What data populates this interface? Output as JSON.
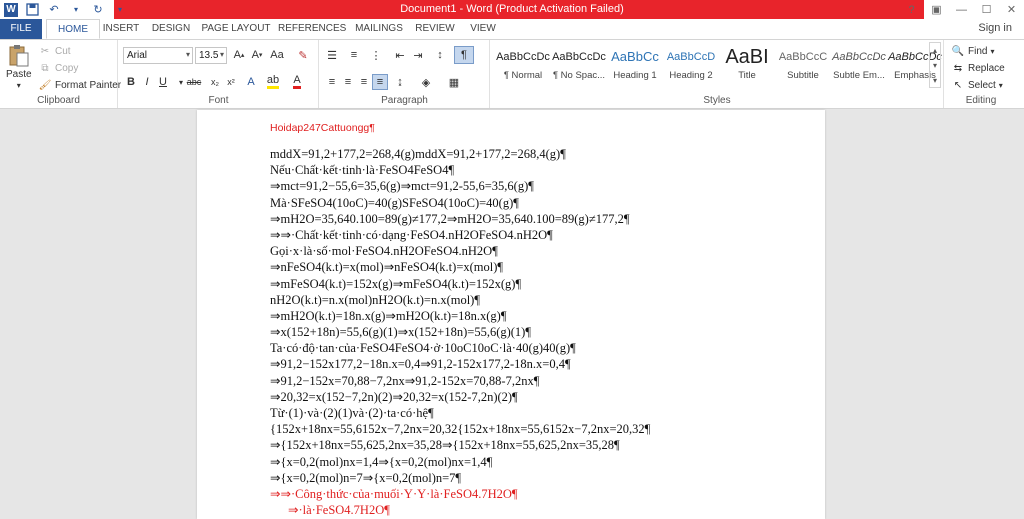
{
  "window": {
    "title": "Document1 - Word (Product Activation Failed)",
    "sign_in": "Sign in"
  },
  "tabs": [
    "FILE",
    "HOME",
    "INSERT",
    "DESIGN",
    "PAGE LAYOUT",
    "REFERENCES",
    "MAILINGS",
    "REVIEW",
    "VIEW"
  ],
  "active_tab": "HOME",
  "clipboard": {
    "paste": "Paste",
    "cut": "Cut",
    "copy": "Copy",
    "format_painter": "Format Painter",
    "label": "Clipboard"
  },
  "font": {
    "family": "Arial",
    "size": "13.5",
    "label": "Font",
    "buttons": [
      "B",
      "I",
      "U",
      "abc",
      "x₂",
      "x²"
    ]
  },
  "paragraph": {
    "label": "Paragraph"
  },
  "styles": {
    "label": "Styles",
    "items": [
      {
        "preview": "AaBbCcDc",
        "name": "¶ Normal"
      },
      {
        "preview": "AaBbCcDc",
        "name": "¶ No Spac..."
      },
      {
        "preview": "AaBbCc",
        "name": "Heading 1"
      },
      {
        "preview": "AaBbCcD",
        "name": "Heading 2"
      },
      {
        "preview": "AaBI",
        "name": "Title"
      },
      {
        "preview": "AaBbCcC",
        "name": "Subtitle"
      },
      {
        "preview": "AaBbCcDc",
        "name": "Subtle Em..."
      },
      {
        "preview": "AaBbCcDc",
        "name": "Emphasis"
      }
    ]
  },
  "editing": {
    "find": "Find",
    "replace": "Replace",
    "select": "Select",
    "label": "Editing"
  },
  "document": {
    "heading": "Hoidap247Cattuongg¶",
    "lines": [
      {
        "text": "mddX=91,2+177,2=268,4(g)mddX=91,2+177,2=268,4(g)¶",
        "red": false,
        "indent": false
      },
      {
        "text": "Nếu·Chất·kết·tinh·là·FeSO4FeSO4¶",
        "red": false,
        "indent": false
      },
      {
        "text": "⇒mct=91,2−55,6=35,6(g)⇒mct=91,2-55,6=35,6(g)¶",
        "red": false,
        "indent": false
      },
      {
        "text": "Mà·SFeSO4(10oC)=40(g)SFeSO4(10oC)=40(g)¶",
        "red": false,
        "indent": false
      },
      {
        "text": "⇒mH2O=35,640.100=89(g)≠177,2⇒mH2O=35,640.100=89(g)≠177,2¶",
        "red": false,
        "indent": false
      },
      {
        "text": "⇒⇒·Chất·kết·tinh·có·dạng·FeSO4.nH2OFeSO4.nH2O¶",
        "red": false,
        "indent": false
      },
      {
        "text": "Gọi·x·là·số·mol·FeSO4.nH2OFeSO4.nH2O¶",
        "red": false,
        "indent": false
      },
      {
        "text": "⇒nFeSO4(k.t)=x(mol)⇒nFeSO4(k.t)=x(mol)¶",
        "red": false,
        "indent": false
      },
      {
        "text": "⇒mFeSO4(k.t)=152x(g)⇒mFeSO4(k.t)=152x(g)¶",
        "red": false,
        "indent": false
      },
      {
        "text": "nH2O(k.t)=n.x(mol)nH2O(k.t)=n.x(mol)¶",
        "red": false,
        "indent": false
      },
      {
        "text": "⇒mH2O(k.t)=18n.x(g)⇒mH2O(k.t)=18n.x(g)¶",
        "red": false,
        "indent": false
      },
      {
        "text": "⇒x(152+18n)=55,6(g)(1)⇒x(152+18n)=55,6(g)(1)¶",
        "red": false,
        "indent": false
      },
      {
        "text": "Ta·có·độ·tan·của·FeSO4FeSO4·ở·10oC10oC·là·40(g)40(g)¶",
        "red": false,
        "indent": false
      },
      {
        "text": "⇒91,2−152x177,2−18n.x=0,4⇒91,2-152x177,2-18n.x=0,4¶",
        "red": false,
        "indent": false
      },
      {
        "text": "⇒91,2−152x=70,88−7,2nx⇒91,2-152x=70,88-7,2nx¶",
        "red": false,
        "indent": false
      },
      {
        "text": "⇒20,32=x(152−7,2n)(2)⇒20,32=x(152-7,2n)(2)¶",
        "red": false,
        "indent": false
      },
      {
        "text": "Từ·(1)·và·(2)(1)và·(2)·ta·có·hệ¶",
        "red": false,
        "indent": false
      },
      {
        "text": "{152x+18nx=55,6152x−7,2nx=20,32{152x+18nx=55,6152x−7,2nx=20,32¶",
        "red": false,
        "indent": false
      },
      {
        "text": "⇒{152x+18nx=55,625,2nx=35,28⇒{152x+18nx=55,625,2nx=35,28¶",
        "red": false,
        "indent": false
      },
      {
        "text": "⇒{x=0,2(mol)nx=1,4⇒{x=0,2(mol)nx=1,4¶",
        "red": false,
        "indent": false
      },
      {
        "text": "⇒{x=0,2(mol)n=7⇒{x=0,2(mol)n=7¶",
        "red": false,
        "indent": false
      },
      {
        "text": "⇒⇒·Công·thức·của·muối·Y·Y·là·FeSO4.7H2O¶",
        "red": true,
        "indent": false
      },
      {
        "text": "⇒·là·FeSO4.7H2O¶",
        "red": true,
        "indent": true
      }
    ]
  },
  "colors": {
    "accent": "#2b579a",
    "titlebar_red": "#e8242b",
    "doc_red": "#e02020"
  }
}
